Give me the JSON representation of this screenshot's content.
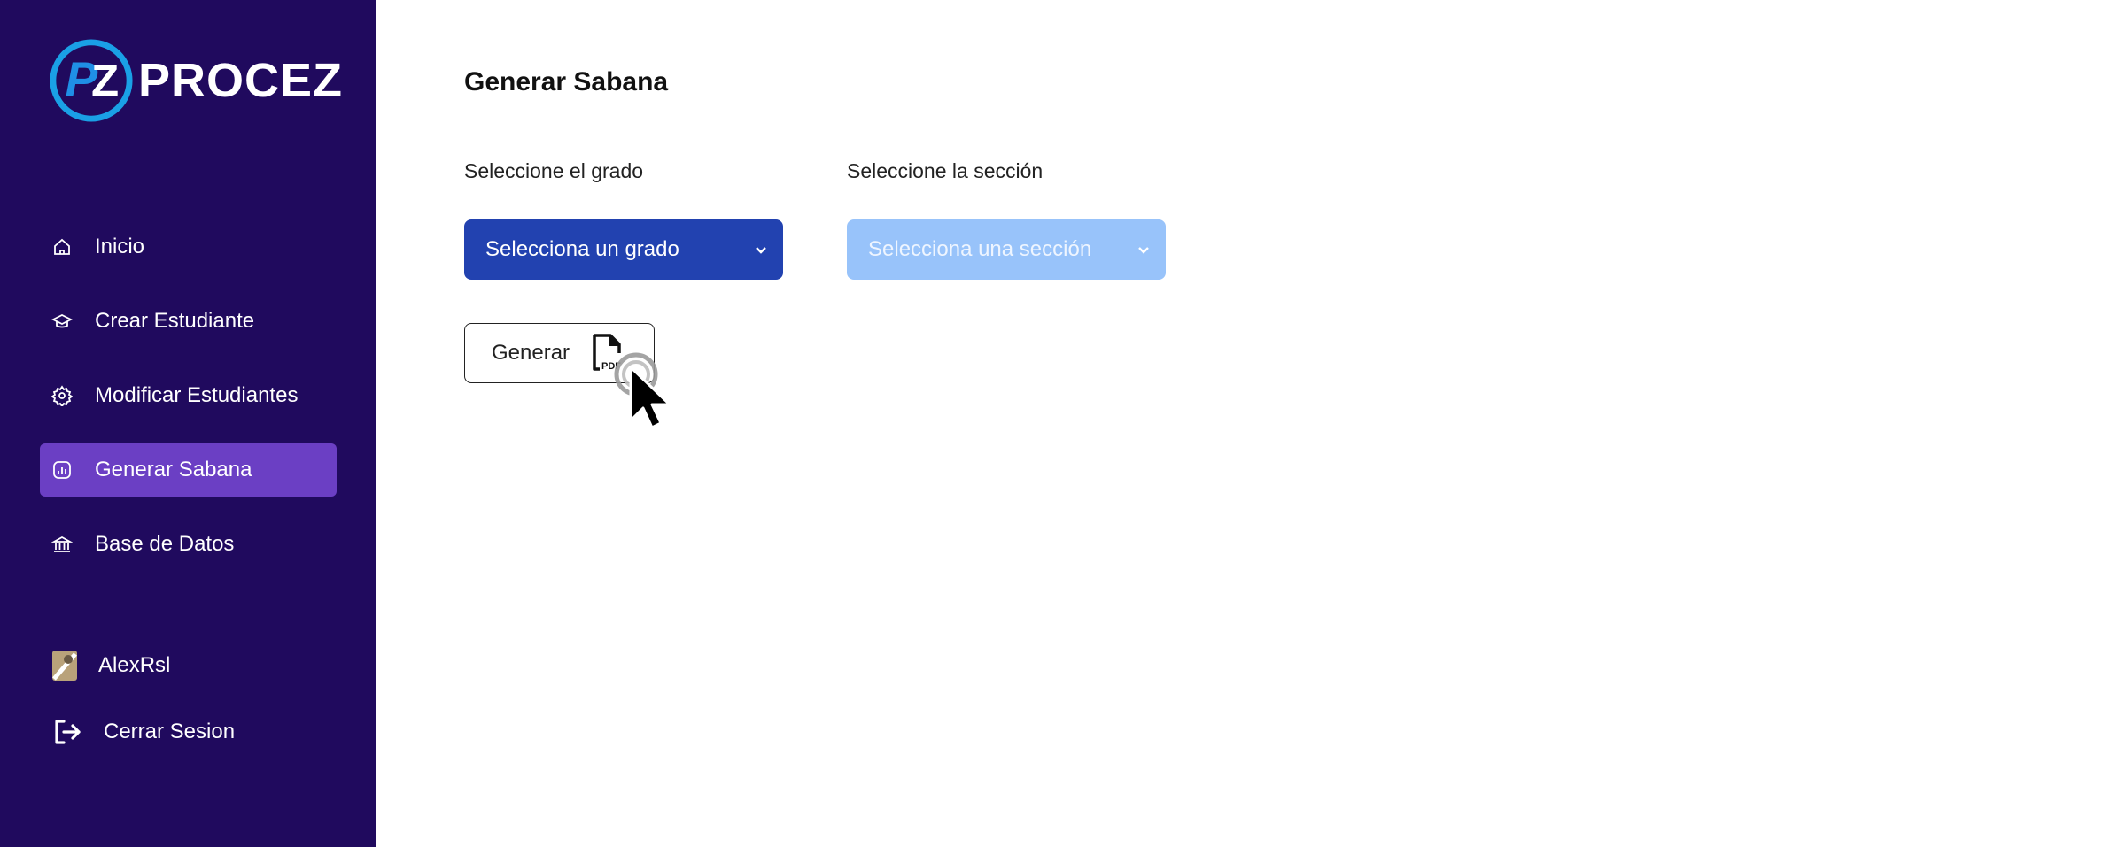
{
  "brand": {
    "name": "PROCEZ",
    "mark": "PZ"
  },
  "sidebar": {
    "items": [
      {
        "label": "Inicio",
        "icon": "home-icon"
      },
      {
        "label": "Crear Estudiante",
        "icon": "graduation-cap-icon"
      },
      {
        "label": "Modificar Estudiantes",
        "icon": "gear-icon"
      },
      {
        "label": "Generar Sabana",
        "icon": "report-icon",
        "active": true
      },
      {
        "label": "Base de Datos",
        "icon": "bank-icon"
      }
    ],
    "user": {
      "name": "AlexRsl",
      "icon": "avatar"
    },
    "logout": {
      "label": "Cerrar Sesion",
      "icon": "logout-icon"
    }
  },
  "main": {
    "title": "Generar Sabana",
    "grado": {
      "label": "Seleccione el grado",
      "selected": "Selecciona un grado"
    },
    "seccion": {
      "label": "Seleccione la sección",
      "selected": "Selecciona una sección"
    },
    "generate_button": {
      "label": "Generar",
      "icon": "pdf-file-icon",
      "icon_text": "PDF"
    }
  },
  "colors": {
    "sidebar_bg": "#200a5e",
    "active_item": "#6b3fc4",
    "select_grado": "#2242b0",
    "select_seccion": "#98c3fa"
  }
}
